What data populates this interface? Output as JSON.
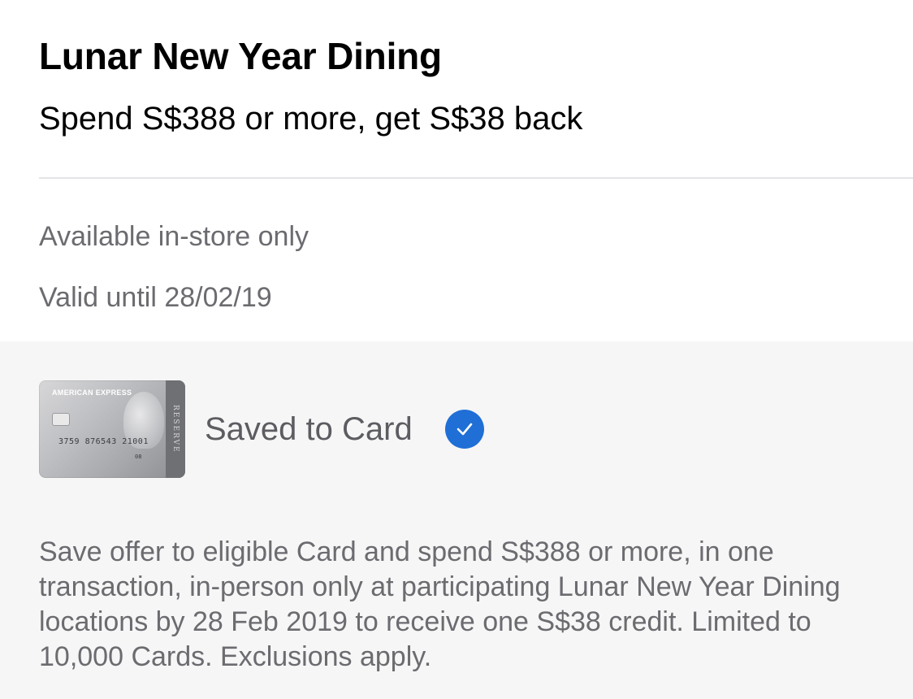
{
  "offer": {
    "title": "Lunar New Year Dining",
    "subtitle": "Spend S$388 or more, get S$38 back"
  },
  "details": {
    "availability": "Available in-store only",
    "validity": "Valid until 28/02/19"
  },
  "card": {
    "brand": "AMERICAN EXPRESS",
    "side_text": "RESERVE",
    "number": "3759 876543 21001",
    "expiry": "08",
    "saved_label": "Saved to Card",
    "saved_icon": "checkmark-circle-icon",
    "accent_color": "#1f6fd6"
  },
  "description": "Save offer to eligible Card and spend S$388 or more, in one transaction,  in-person only at participating Lunar New Year Dining locations by 28 Feb 2019 to receive one S$38 credit. Limited to 10,000 Cards. Exclusions apply."
}
